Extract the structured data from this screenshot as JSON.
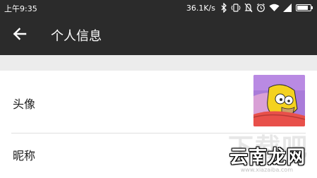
{
  "status_bar": {
    "time": "上午9:35",
    "network_speed": "36.1K/s",
    "battery_level": 0.85
  },
  "app_bar": {
    "title": "个人信息"
  },
  "rows": {
    "avatar_label": "头像",
    "nickname_label": "昵称"
  },
  "watermark": {
    "large_text": "下载吧",
    "brand": "云南龙网",
    "url": "www.xiazaiba.com"
  },
  "colors": {
    "bar_background": "#2b2b2b",
    "separator_band": "#ececec",
    "text_primary": "#1a1a1a"
  }
}
